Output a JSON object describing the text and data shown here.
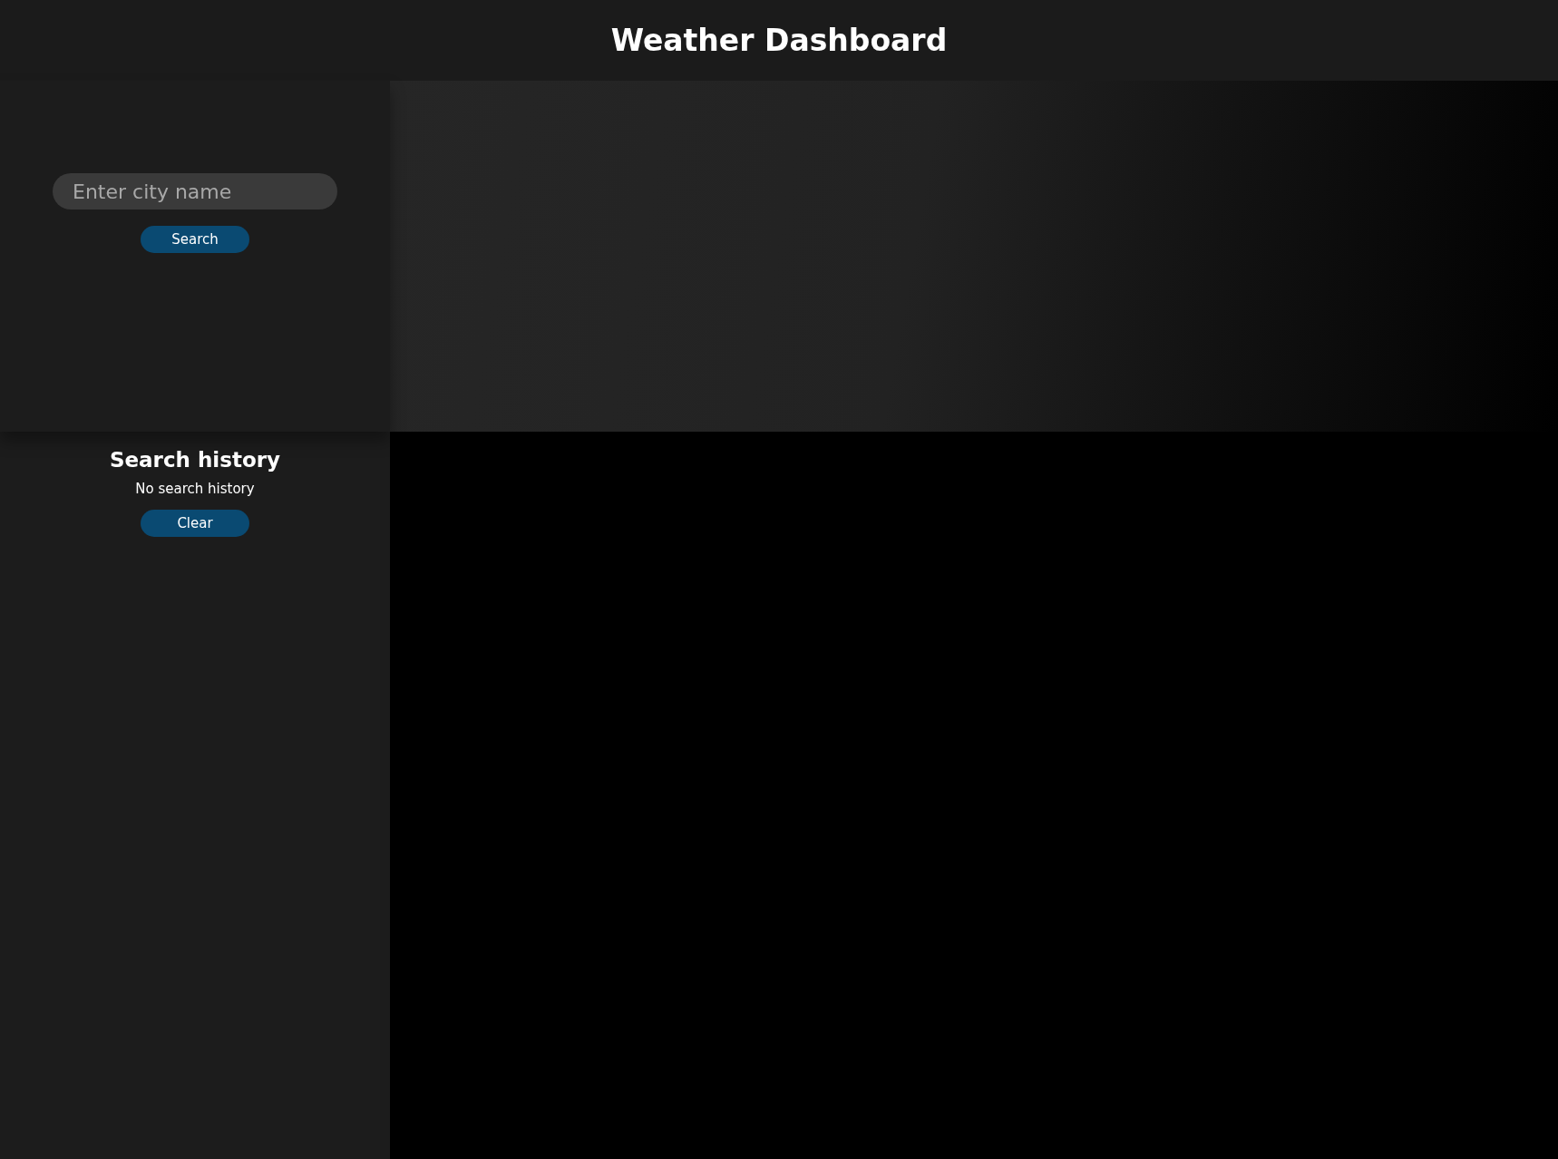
{
  "header": {
    "title": "Weather Dashboard"
  },
  "search": {
    "placeholder": "Enter city name",
    "button": "Search"
  },
  "history": {
    "title": "Search history",
    "empty_text": "No search history",
    "button": "Clear"
  }
}
